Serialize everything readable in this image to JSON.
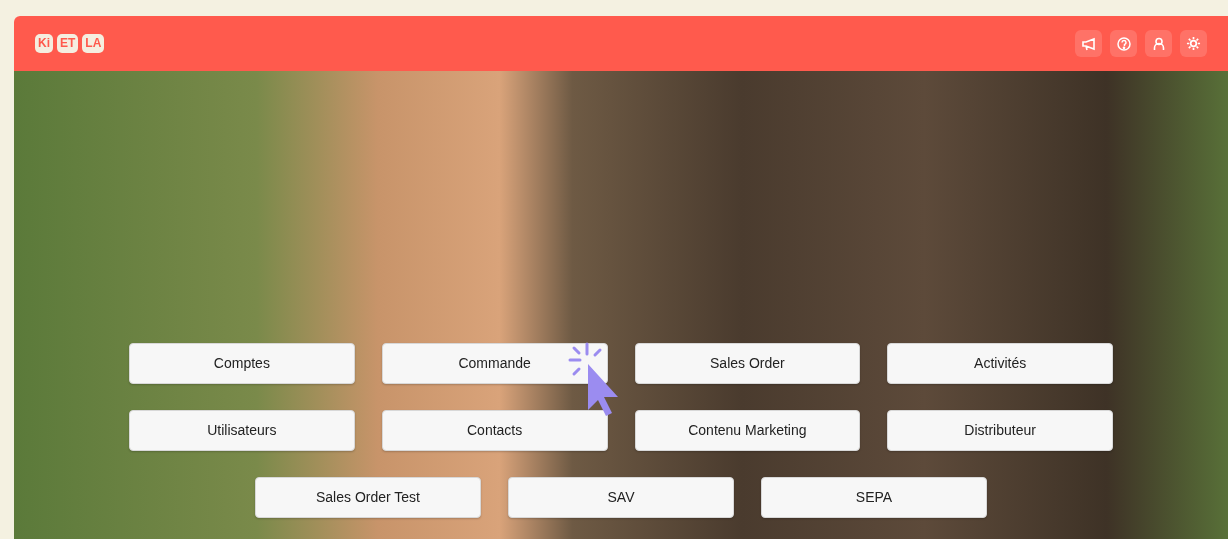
{
  "logo": [
    "Ki",
    "ET",
    "LA"
  ],
  "menu_rows": [
    [
      "Comptes",
      "Commande",
      "Sales Order",
      "Activités"
    ],
    [
      "Utilisateurs",
      "Contacts",
      "Contenu Marketing",
      "Distributeur"
    ],
    [
      "Sales Order Test",
      "SAV",
      "SEPA"
    ]
  ]
}
